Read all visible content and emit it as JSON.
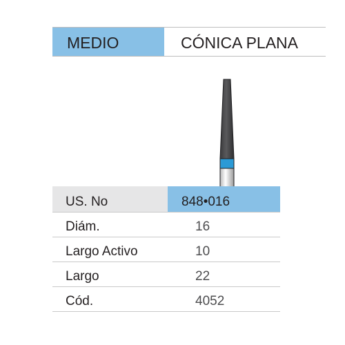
{
  "header": {
    "category": "MEDIO",
    "shape": "CÓNICA PLANA"
  },
  "colors": {
    "accent_blue": "#88c0e6",
    "band_blue": "#2b9ad6",
    "grey_row": "#e6e6e7",
    "bur_dark": "#4a4a4c"
  },
  "illustration": {
    "icon": "tapered-flat-end-diamond-bur"
  },
  "specs": [
    {
      "label": "US. No",
      "value": "848•016"
    },
    {
      "label": "Diám.",
      "value": "16"
    },
    {
      "label": "Largo Activo",
      "value": "10"
    },
    {
      "label": "Largo",
      "value": "22"
    },
    {
      "label": "Cód.",
      "value": "4052"
    }
  ]
}
